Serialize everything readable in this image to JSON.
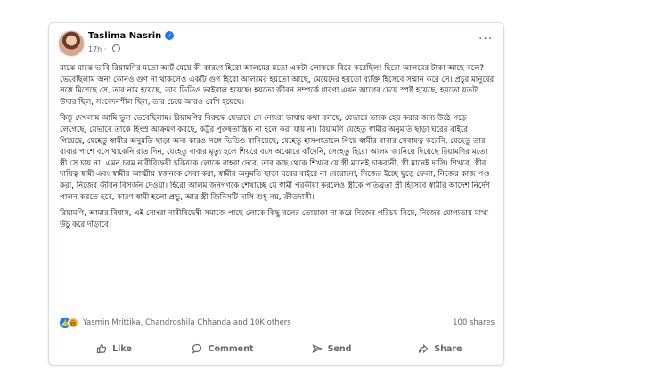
{
  "post": {
    "author": "Taslima Nasrin",
    "time": "17h",
    "separator": "·",
    "more_icon": "···",
    "paragraphs": [
      "মাঝে মাঝে ভাবি রিয়ামণির মতো আর্ট মেয়ে কী কারণে হিরো আলমের মতো একটা লোককে বিয়ে করেছিল! হিরো আলমের টাকা আছে বলে? ভেবেছিলাম অন্য কোনও গুণ না থাকলেও একটি গুণ হিরো আলমের হয়তো আছে, মেয়েদের হয়তো ব্যক্তি হিসেবে সম্মান করে সে। প্রচুর মানুষের সঙ্গে মিশেছে সে, তার নাম হয়েছে, তার ভিডিও ভাইরাল হয়েছে। হয়তো জীবন সম্পর্কে ধারণা এখন আগের চেয়ে স্পষ্ট হয়েছে, হয়তো যতটা উদার ছিল, সংবেদনশীল ছিল, তার চেয়ে আরও বেশি হয়েছে।",
      "কিন্তু দেখলাম আমি ভুল ভেবেছিলাম। রিয়ামণির বিরুদ্ধে যেভাবে সে নোংরা ভাষায় কথা বলছে, যেভাবে তাকে হেয় করার জন্য উঠে পড়ে লেগেছে, যেভাবে তাকে হিংস্র আক্রমণ করছে, কট্টর পুরুষতান্ত্রিক না হলে করা যায় না। রিয়ামণি যেহেতু স্বামীর অনুমতি ছাড়া ঘরের বাইরে গিয়েছে, যেহেতু স্বামীর অনুমতি ছাড়া অন্য কারও সঙ্গে ভিডিও বানিয়েছে, যেহেতু হাসপাতালে গিয়ে স্বামীর বাবার সেবাযত্ন করেনি, যেহেতু তার বাবার পাশে বসে থাকেনি রাত দিন, যেহেতু বাবার মৃত্যু হলে শিয়রে বসে অঝোরে কাঁদেনি, সেহেতু হিরো আলম জানিয়ে দিয়েছে রিয়ামণির মতো স্ত্রী সে চায় না। এমন চরম নারীবিদ্বেষী চরিত্রকে লোকে বাহবা দেবে, তার কাছ থেকে শিখবে যে স্ত্রী মানেই চাকরানী, স্ত্রী মানেই দাসি। শিখবে, স্ত্রীর দায়িত্ব স্বামী এবং স্বামীর আত্মীয় স্বজনকে সেবা করা, স্বামীর অনুমতি ছাড়া ঘরের বাইরে না বেরোনো, নিজের ইচ্ছে ছুড়ে ফেলা, নিজের কাজ পণ্ড করা, নিজের জীবন বিসর্জন দেওয়া। হিরো আলম জনগণকে শেখাচ্ছে যে স্বামী পরকীয়া করলেও স্ত্রীকে পতিব্রতা স্ত্রী হিসেবে স্বামীর আদেশ নির্দেশ পালন করতে হবে, কারণ স্বামী হলো প্রভু, আর স্ত্রী জিনিসটি দাসি শুধু নয়, ক্রীতদাসী।",
      "রিয়ামণি, আমার বিশ্বাস, এই নোংরা নারীবিদ্বেষী সমাজে পাছে লোকে কিছু বলের তোয়াক্কা না করে নিজের পরিচয় নিয়ে, নিজের যোগ্যতায় মাথা উঁচু করে দাঁড়াবে।"
    ]
  },
  "reactions": {
    "names": "Yasmin Mrittika, Chandroshila Chhanda and 10K others",
    "shares": "100 shares"
  },
  "actions": {
    "like": "Like",
    "comment": "Comment",
    "send": "Send",
    "share": "Share"
  },
  "icons": {
    "avatar": "profile-photo",
    "verified": "verified-badge-icon",
    "privacy": "globe-icon",
    "like": "thumbs-up-icon",
    "comment": "speech-bubble-icon",
    "send": "paper-plane-icon",
    "share": "share-arrow-icon"
  },
  "colors": {
    "accent": "#1877f2",
    "secondary_text": "#65676b",
    "border": "#dadde1"
  }
}
